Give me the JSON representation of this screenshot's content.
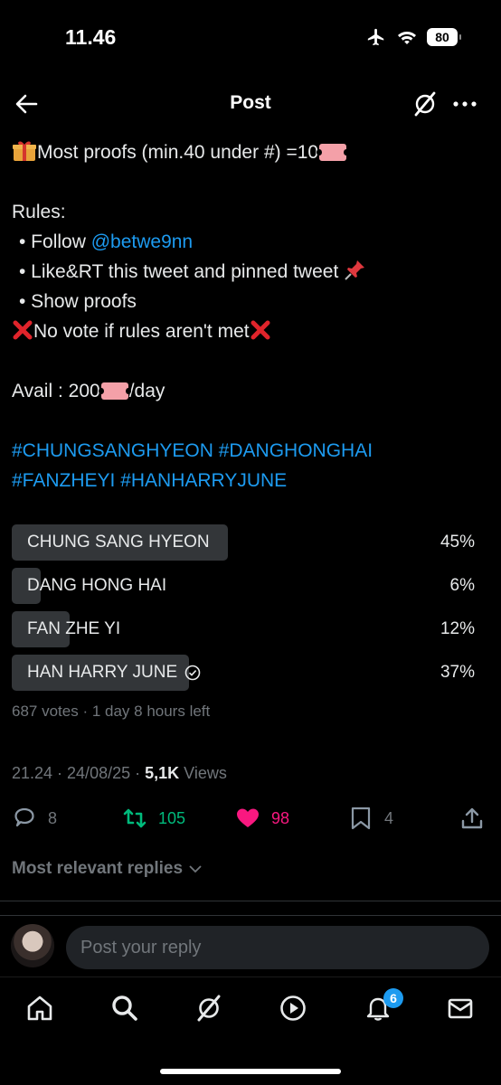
{
  "status_bar": {
    "time": "11.46",
    "battery": "80"
  },
  "header": {
    "title": "Post"
  },
  "tweet": {
    "line1": "Most proofs (min.40 under #) =10",
    "rules_title": "Rules:",
    "rule1_prefix": "• Follow ",
    "rule1_handle": "@betwe9nn",
    "rule2": "• Like&RT this tweet and pinned tweet",
    "rule3": "• Show proofs",
    "no_vote": "No vote if rules aren't met",
    "avail_prefix": "Avail : 200",
    "avail_suffix": "/day",
    "hashtags_line1": "#CHUNGSANGHYEON #DANGHONGHAI",
    "hashtags_line2": "#FANZHEYI #HANHARRYJUNE"
  },
  "poll": {
    "options": [
      {
        "label": "CHUNG SANG HYEON",
        "pct_text": "45%",
        "pct": 45
      },
      {
        "label": "DANG HONG HAI",
        "pct_text": "6%",
        "pct": 6
      },
      {
        "label": "FAN ZHE YI",
        "pct_text": "12%",
        "pct": 12
      },
      {
        "label": "HAN HARRY JUNE",
        "pct_text": "37%",
        "pct": 37,
        "selected": true
      }
    ],
    "meta": "687 votes · 1 day 8 hours left"
  },
  "timestamp": {
    "datetime": "21.24 · 24/08/25 · ",
    "views_count": "5,1K",
    "views_label": " Views"
  },
  "actions": {
    "replies": "8",
    "reposts": "105",
    "likes": "98",
    "bookmarks": "4"
  },
  "replies_sort": "Most relevant replies",
  "reply_box": {
    "placeholder": "Post your reply"
  },
  "nav": {
    "notifications_badge": "6"
  },
  "colors": {
    "accent": "#1d9bf0",
    "repost": "#00ba7c",
    "like": "#f91880",
    "poll_bar": "#333639"
  }
}
